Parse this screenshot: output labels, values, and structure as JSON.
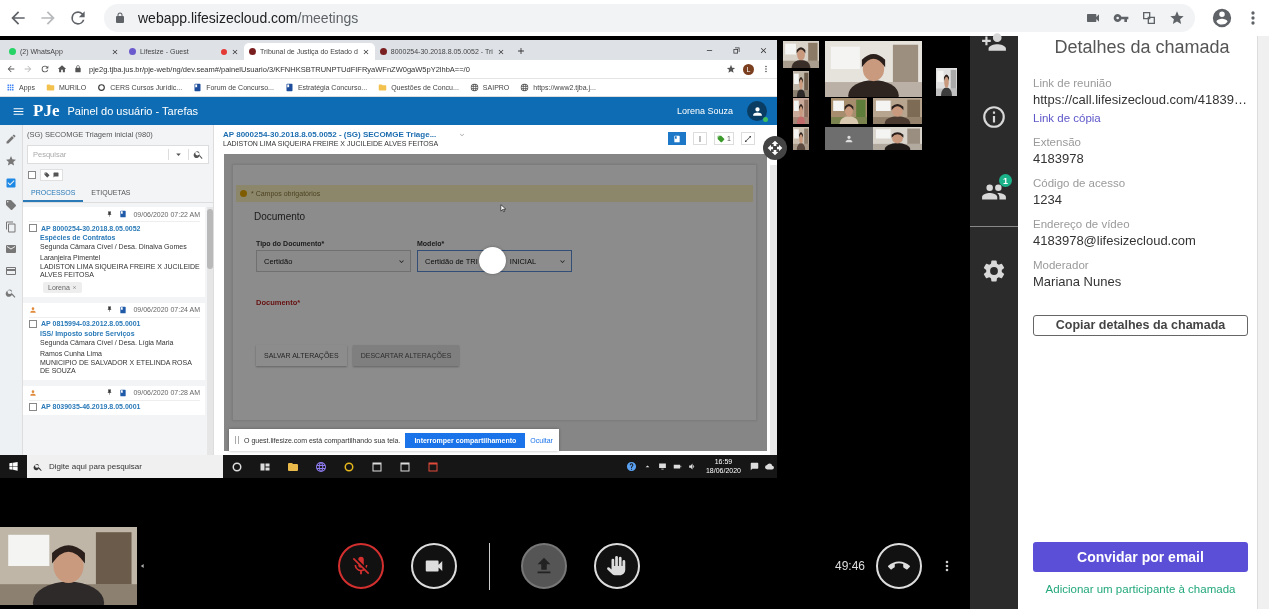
{
  "browser": {
    "url_host": "webapp.lifesizecloud.com",
    "url_path": "/meetings"
  },
  "shared_screen": {
    "tabs": [
      {
        "label": "(2) WhatsApp",
        "selected": false,
        "recording": false,
        "kind": "chat"
      },
      {
        "label": "Lifesize - Guest",
        "selected": false,
        "recording": true,
        "kind": "video"
      },
      {
        "label": "Tribunal de Justiça do Estado d",
        "selected": true,
        "recording": false,
        "kind": "court"
      },
      {
        "label": "8000254-30.2018.8.05.0052 - Tri",
        "selected": false,
        "recording": false,
        "kind": "court"
      }
    ],
    "url": "pje2g.tjba.jus.br/pje-web/ng/dev.seam#/painelUsuario/3/KFNHKSBTRUNPTUdFIFRyaWFnZW0gaW5pY2lhbA==/0",
    "profile_initial": "L",
    "bookmarks": [
      {
        "label": "Apps",
        "kind": "apps"
      },
      {
        "label": "MURILO",
        "kind": "folder"
      },
      {
        "label": "CERS Cursos Jurídic...",
        "kind": "site"
      },
      {
        "label": "Forum de Concurso...",
        "kind": "page"
      },
      {
        "label": "Estratégia Concurso...",
        "kind": "page"
      },
      {
        "label": "Questões de Concu...",
        "kind": "folder"
      },
      {
        "label": "SAIPRO",
        "kind": "globe"
      },
      {
        "label": "https://www2.tjba.j...",
        "kind": "globe"
      }
    ],
    "logo": "PJe",
    "app_title": "Painel do usuário - Tarefas",
    "user_name": "Lorena Souza",
    "task_panel": {
      "title": "(SG) SECOMGE Triagem inicial (980)",
      "search_placeholder": "Pesquisar",
      "select_all_checked": false,
      "tabs": [
        {
          "label": "PROCESSOS",
          "selected": true
        },
        {
          "label": "ETIQUETAS",
          "selected": false
        }
      ],
      "items": [
        {
          "assigned": false,
          "checked": false,
          "date": "09/06/2020 07:22 AM",
          "number": "AP 8000254-30.2018.8.05.0052",
          "subject": "Espécies de Contratos",
          "court": "Segunda Câmara Cível / Desa. Dinalva Gomes",
          "judge_line": "Laranjeira Pimentel",
          "parties": "LADISTON LIMA SIQUEIRA FREIRE X JUCILEIDE ALVES FEITOSA",
          "tags": [
            "Lorena"
          ]
        },
        {
          "assigned": true,
          "checked": false,
          "date": "09/06/2020 07:24 AM",
          "number": "AP 0815994-03.2012.8.05.0001",
          "subject": "ISS/ Imposto sobre Serviços",
          "court": "Segunda Câmara Cível / Desa. Lígia Maria",
          "judge_line": "Ramos Cunha Lima",
          "parties": "MUNICIPIO DE SALVADOR X ETELINDA ROSA DE SOUZA"
        },
        {
          "assigned": true,
          "checked": false,
          "date": "09/06/2020 07:28 AM",
          "number": "AP 8039035-46.2019.8.05.0001"
        }
      ]
    },
    "document": {
      "title": "AP 8000254-30.2018.8.05.0052 - (SG) SECOMGE Triage...",
      "parties": "LADISTON LIMA SIQUEIRA FREIRE X JUCILEIDE ALVES FEITOSA",
      "tag_count": "1",
      "loading": true,
      "required_note": "* Campos obrigatórios",
      "section": "Documento",
      "fields": [
        {
          "label": "Tipo do Documento*",
          "value": "Certidão",
          "focused": false
        },
        {
          "label": "Modelo*",
          "value": "Certidão de TRI",
          "value_tail": "INICIAL",
          "focused": true
        }
      ],
      "editor_label": "Documento*",
      "buttons": [
        {
          "label": "SALVAR ALTERAÇÕES",
          "disabled": false
        },
        {
          "label": "DESCARTAR ALTERAÇÕES",
          "disabled": true
        }
      ]
    },
    "share_notice": {
      "text": "O guest.lifesize.com está compartilhando sua tela.",
      "stop": "Interromper compartilhamento",
      "hide": "Ocultar"
    },
    "taskbar": {
      "search_placeholder": "Digite aqui para pesquisar",
      "time": "16:59",
      "date": "18/06/2020"
    }
  },
  "call": {
    "timer": "49:46",
    "muted": true,
    "participants_badge": "1"
  },
  "details": {
    "title": "Detalhes da chamada",
    "fields": [
      {
        "label": "Link de reunião",
        "value": "https://call.lifesizecloud.com/41839…",
        "link": "Link de cópia"
      },
      {
        "label": "Extensão",
        "value": "4183978"
      },
      {
        "label": "Código de acesso",
        "value": "1234"
      },
      {
        "label": "Endereço de vídeo",
        "value": "4183978@lifesizecloud.com"
      },
      {
        "label": "Moderador",
        "value": "Mariana Nunes"
      }
    ],
    "copy_button": "Copiar detalhes da chamada",
    "invite_button": "Convidar por email",
    "add_link": "Adicionar um participante à chamada"
  }
}
